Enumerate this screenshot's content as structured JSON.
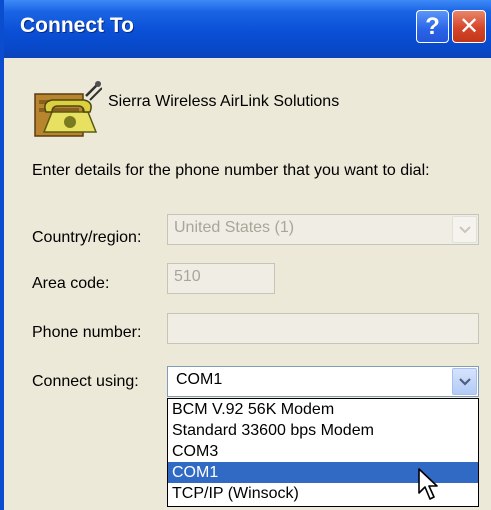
{
  "window": {
    "title": "Connect To"
  },
  "titlebar_buttons": {
    "help": "?",
    "close": "✕"
  },
  "header": {
    "connection_name": "Sierra Wireless AirLink Solutions"
  },
  "prompt": "Enter details for the phone number that you want to dial:",
  "fields": {
    "country": {
      "label": "Country/region:",
      "value": "United States (1)",
      "enabled": false
    },
    "area_code": {
      "label": "Area code:",
      "value": "510",
      "enabled": false
    },
    "phone_number": {
      "label": "Phone number:",
      "value": "",
      "enabled": false
    },
    "connect_using": {
      "label": "Connect using:",
      "value": "COM1",
      "enabled": true
    }
  },
  "dropdown_options": [
    {
      "label": "BCM V.92 56K Modem",
      "selected": false
    },
    {
      "label": "Standard 33600 bps Modem",
      "selected": false
    },
    {
      "label": "COM3",
      "selected": false
    },
    {
      "label": "COM1",
      "selected": true
    },
    {
      "label": "TCP/IP (Winsock)",
      "selected": false
    }
  ],
  "colors": {
    "titlebar": "#0a4fd6",
    "dialog_bg": "#ece9d8",
    "selection": "#316ac5",
    "disabled_text": "#a7a69a"
  },
  "icons": [
    "phone-icon",
    "help-icon",
    "close-icon",
    "chevron-down-icon",
    "mouse-cursor-icon"
  ]
}
